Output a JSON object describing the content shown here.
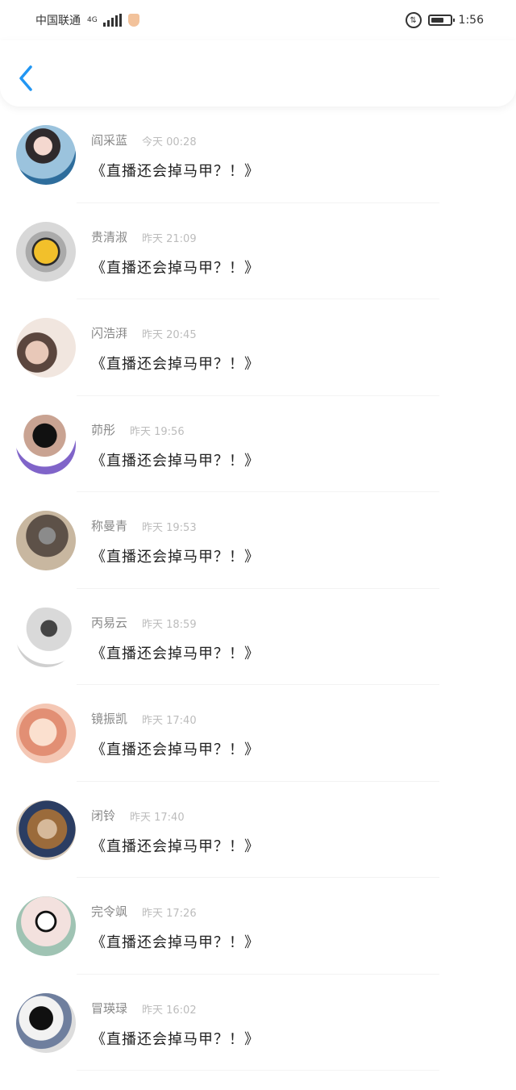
{
  "status_bar": {
    "carrier": "中国联通",
    "network": "4G",
    "time": "1:56",
    "battery_level": 0.7
  },
  "header": {
    "back_icon": "chevron-left-icon"
  },
  "colors": {
    "accent": "#2196f3",
    "name": "#888888",
    "time": "#bcbcbc",
    "content": "#222222"
  },
  "messages": [
    {
      "name": "阎采蓝",
      "time": "今天 00:28",
      "content": "《直播还会掉马甲？！》"
    },
    {
      "name": "贵清淑",
      "time": "昨天 21:09",
      "content": "《直播还会掉马甲？！》"
    },
    {
      "name": "闪浩湃",
      "time": "昨天 20:45",
      "content": "《直播还会掉马甲？！》"
    },
    {
      "name": "茆彤",
      "time": "昨天 19:56",
      "content": "《直播还会掉马甲？！》"
    },
    {
      "name": "称曼青",
      "time": "昨天 19:53",
      "content": "《直播还会掉马甲？！》"
    },
    {
      "name": "丙易云",
      "time": "昨天 18:59",
      "content": "《直播还会掉马甲？！》"
    },
    {
      "name": "镜振凯",
      "time": "昨天 17:40",
      "content": "《直播还会掉马甲？！》"
    },
    {
      "name": "闭铃",
      "time": "昨天 17:40",
      "content": "《直播还会掉马甲？！》"
    },
    {
      "name": "完令飒",
      "time": "昨天 17:26",
      "content": "《直播还会掉马甲？！》"
    },
    {
      "name": "冒瑛琭",
      "time": "昨天 16:02",
      "content": "《直播还会掉马甲？！》"
    }
  ]
}
